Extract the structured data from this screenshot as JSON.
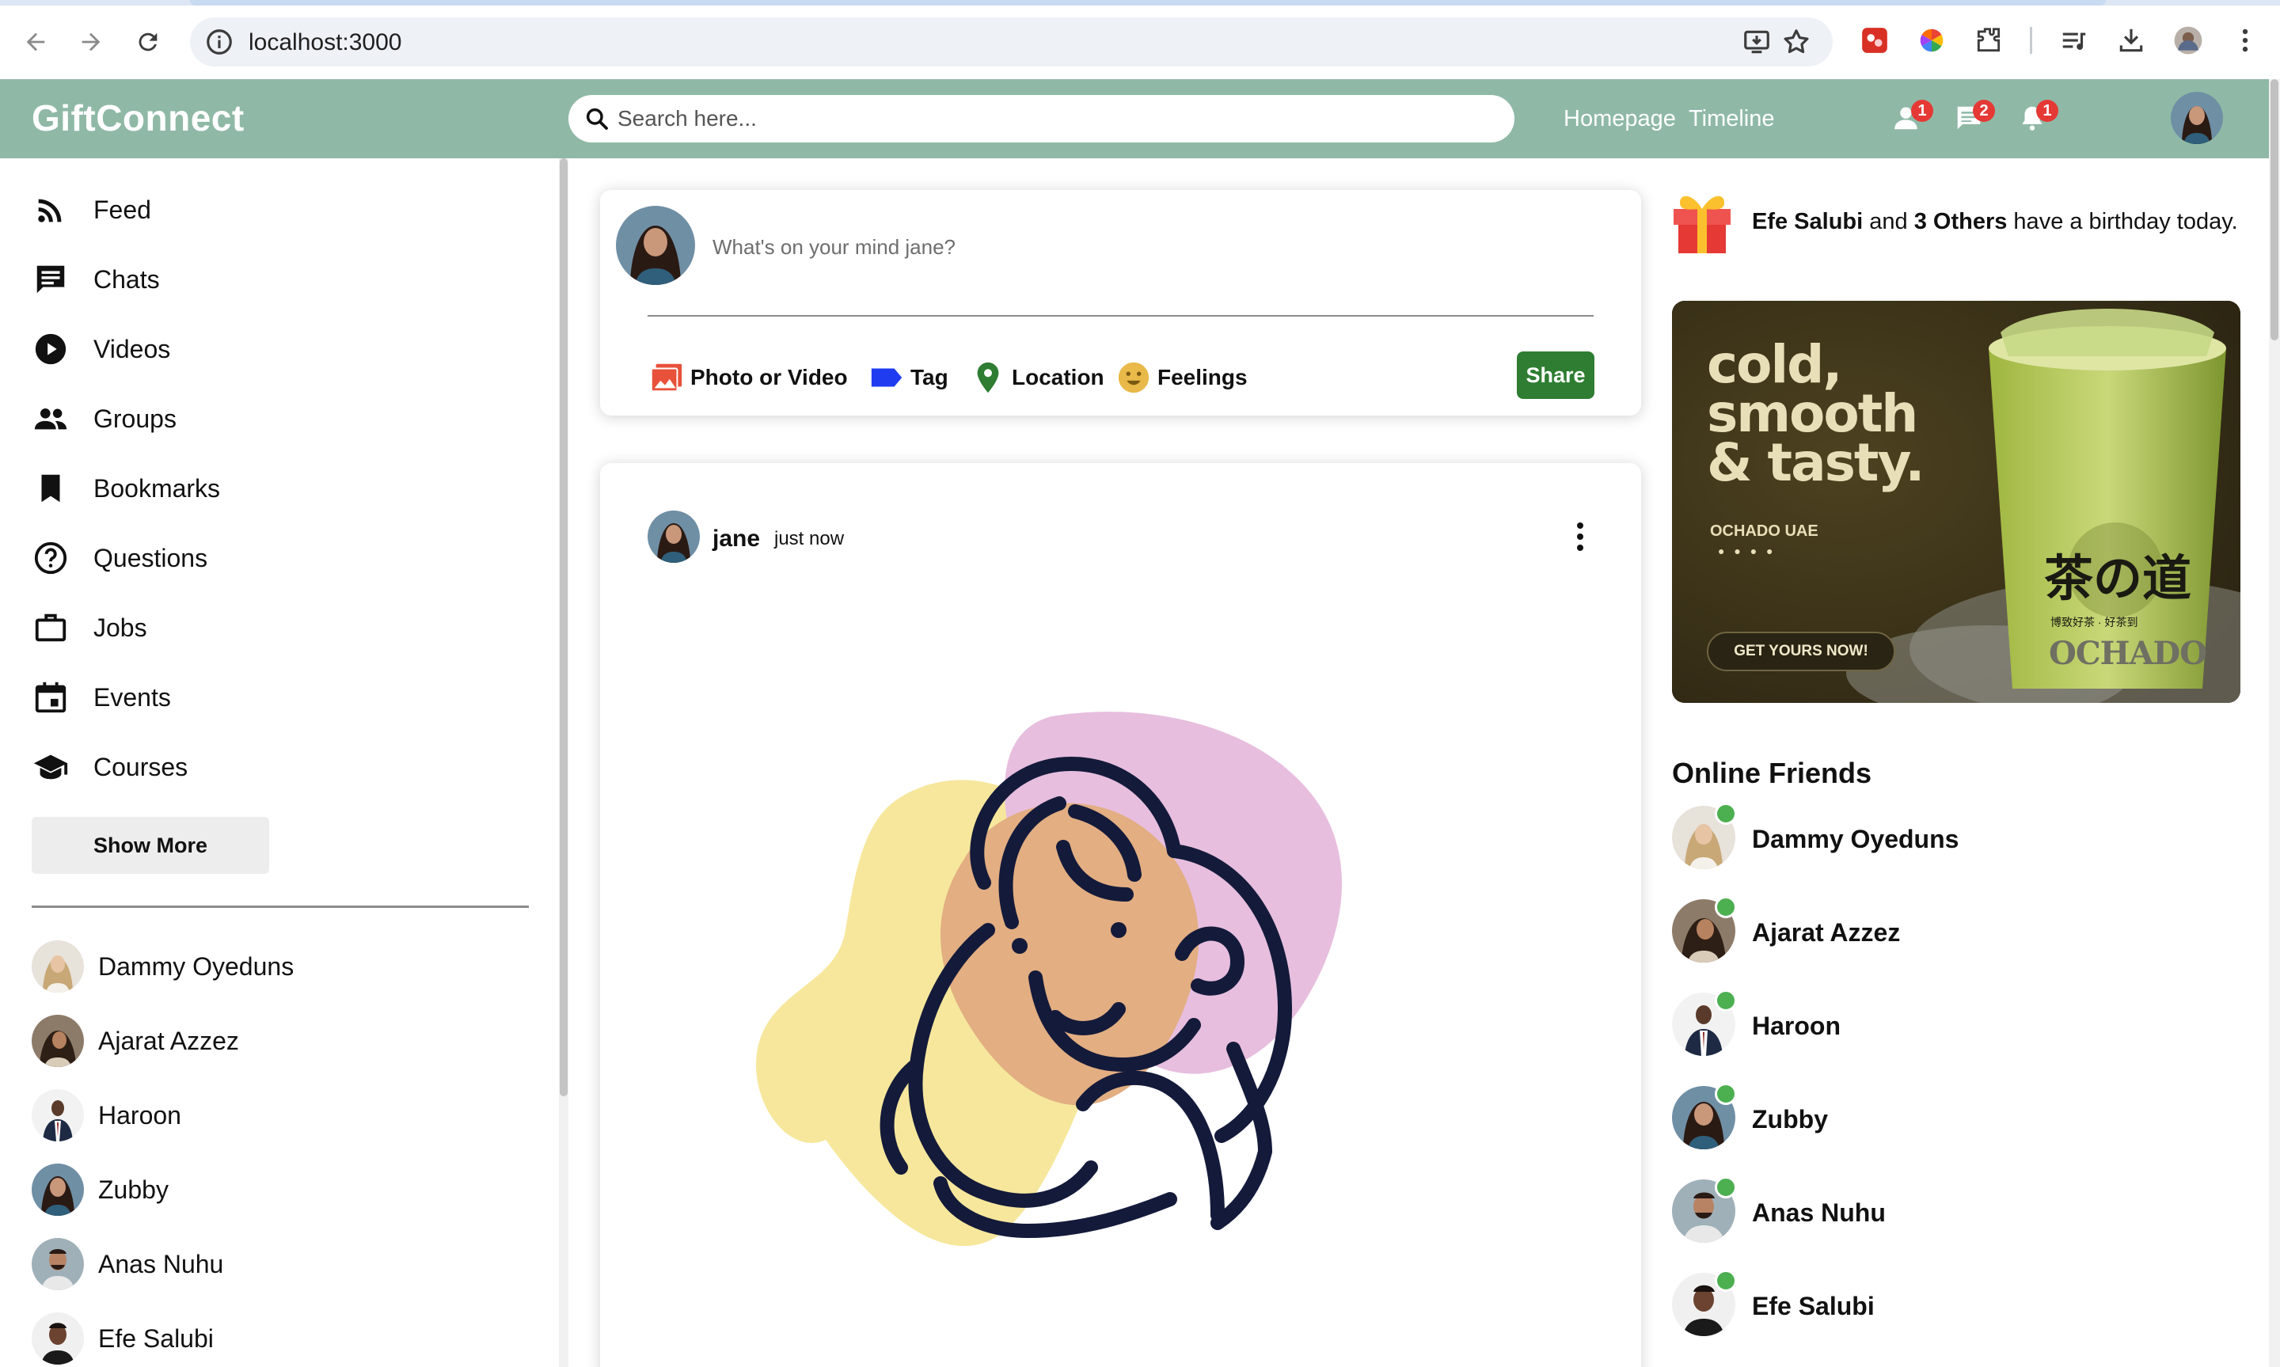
{
  "browser": {
    "url": "localhost:3000"
  },
  "app": {
    "logo": "GiftConnect",
    "search_placeholder": "Search here...",
    "nav_links": [
      "Homepage",
      "Timeline"
    ],
    "badges": {
      "friend_requests": "1",
      "messages": "2",
      "notifications": "1"
    }
  },
  "sidebar": {
    "items": [
      {
        "label": "Feed",
        "icon": "rss-feed-icon"
      },
      {
        "label": "Chats",
        "icon": "chat-icon"
      },
      {
        "label": "Videos",
        "icon": "play-circle-icon"
      },
      {
        "label": "Groups",
        "icon": "group-icon"
      },
      {
        "label": "Bookmarks",
        "icon": "bookmark-icon"
      },
      {
        "label": "Questions",
        "icon": "help-circle-icon"
      },
      {
        "label": "Jobs",
        "icon": "briefcase-icon"
      },
      {
        "label": "Events",
        "icon": "calendar-icon"
      },
      {
        "label": "Courses",
        "icon": "school-icon"
      }
    ],
    "show_more": "Show More",
    "friends": [
      "Dammy Oyeduns",
      "Ajarat Azzez",
      "Haroon",
      "Zubby",
      "Anas Nuhu",
      "Efe Salubi"
    ]
  },
  "share": {
    "placeholder": "What's on your mind jane?",
    "options": [
      "Photo or Video",
      "Tag",
      "Location",
      "Feelings"
    ],
    "button": "Share"
  },
  "post": {
    "username": "jane",
    "time": "just now"
  },
  "rightbar": {
    "birthday": {
      "name": "Efe Salubi",
      "mid": " and ",
      "others": "3 Others",
      "tail": " have a birthday today."
    },
    "ad": {
      "headline": [
        "cold,",
        "smooth",
        "& tasty."
      ],
      "brand": "OCHADO UAE",
      "cta": "GET YOURS NOW!",
      "cn": "茶の道",
      "sub": "博致好茶 · 好茶到",
      "brand2": "OCHADO"
    },
    "online_title": "Online Friends",
    "online_friends": [
      "Dammy Oyeduns",
      "Ajarat Azzez",
      "Haroon",
      "Zubby",
      "Anas Nuhu",
      "Efe Salubi"
    ]
  },
  "colors": {
    "topbar": "#8fb9a6",
    "share_button": "#2e7d32",
    "badge": "#e53935",
    "online_dot": "#4caf50"
  }
}
